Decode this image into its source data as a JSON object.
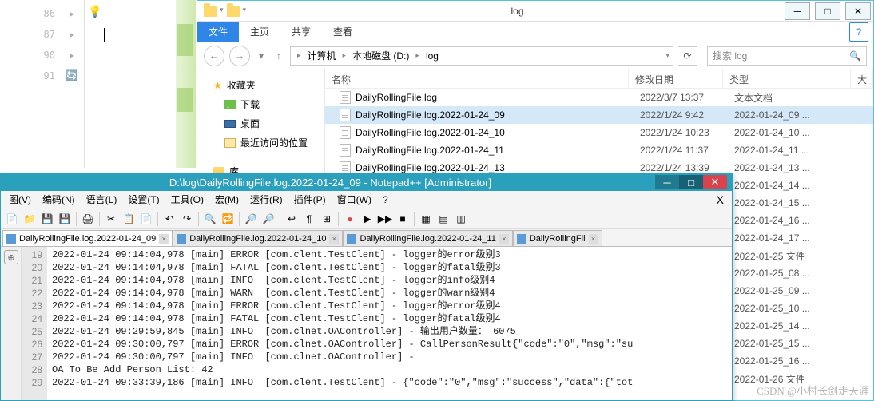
{
  "ide": {
    "lines": [
      "86",
      "87",
      "90",
      "91"
    ],
    "icons": {
      "bulb": "💡",
      "sync": "🔄"
    }
  },
  "explorer": {
    "title": "log",
    "ribbon": {
      "file": "文件",
      "home": "主页",
      "share": "共享",
      "view": "查看"
    },
    "nav": {
      "back": "←",
      "fwd": "→",
      "up": "↑",
      "refresh": "⟳"
    },
    "breadcrumb": {
      "computer": "计算机",
      "drive": "本地磁盘 (D:)",
      "folder": "log"
    },
    "search_placeholder": "搜索 log",
    "sidebar": {
      "fav": "收藏夹",
      "downloads": "下载",
      "desktop": "桌面",
      "recent": "最近访问的位置",
      "lib": "库"
    },
    "columns": {
      "name": "名称",
      "date": "修改日期",
      "type": "类型",
      "size": "大"
    },
    "rows": [
      {
        "name": "DailyRollingFile.log",
        "date": "2022/3/7 13:37",
        "type": "文本文档"
      },
      {
        "name": "DailyRollingFile.log.2022-01-24_09",
        "date": "2022/1/24 9:42",
        "type": "2022-01-24_09 ...",
        "sel": true
      },
      {
        "name": "DailyRollingFile.log.2022-01-24_10",
        "date": "2022/1/24 10:23",
        "type": "2022-01-24_10 ..."
      },
      {
        "name": "DailyRollingFile.log.2022-01-24_11",
        "date": "2022/1/24 11:37",
        "type": "2022-01-24_11 ..."
      },
      {
        "name": "DailyRollingFile.log.2022-01-24_13",
        "date": "2022/1/24 13:39",
        "type": "2022-01-24_13 ..."
      },
      {
        "name": "",
        "date": "",
        "type": "2022-01-24_14 ..."
      },
      {
        "name": "",
        "date": "",
        "type": "2022-01-24_15 ..."
      },
      {
        "name": "",
        "date": "",
        "type": "2022-01-24_16 ..."
      },
      {
        "name": "",
        "date": "",
        "type": "2022-01-24_17 ..."
      },
      {
        "name": "",
        "date": "",
        "type": "2022-01-25 文件"
      },
      {
        "name": "",
        "date": "",
        "type": "2022-01-25_08 ..."
      },
      {
        "name": "",
        "date": "",
        "type": "2022-01-25_09 ..."
      },
      {
        "name": "",
        "date": "",
        "type": "2022-01-25_10 ..."
      },
      {
        "name": "",
        "date": "",
        "type": "2022-01-25_14 ..."
      },
      {
        "name": "",
        "date": "",
        "type": "2022-01-25_15 ..."
      },
      {
        "name": "",
        "date": "",
        "type": "2022-01-25_16 ..."
      },
      {
        "name": "",
        "date": "",
        "type": "2022-01-26 文件"
      }
    ]
  },
  "npp": {
    "title": "D:\\log\\DailyRollingFile.log.2022-01-24_09 - Notepad++ [Administrator]",
    "menu": [
      "图(V)",
      "编码(N)",
      "语言(L)",
      "设置(T)",
      "工具(O)",
      "宏(M)",
      "运行(R)",
      "插件(P)",
      "窗口(W)",
      "?"
    ],
    "tabs": [
      {
        "label": "DailyRollingFile.log.2022-01-24_09",
        "active": true
      },
      {
        "label": "DailyRollingFile.log.2022-01-24_10"
      },
      {
        "label": "DailyRollingFile.log.2022-01-24_11"
      },
      {
        "label": "DailyRollingFil"
      }
    ],
    "gutter": [
      "19",
      "20",
      "21",
      "22",
      "23",
      "24",
      "25",
      "26",
      "27",
      "28",
      "29"
    ],
    "lines": [
      "2022-01-24 09:14:04,978 [main] ERROR [com.clent.TestClent] - logger的error级别3",
      "2022-01-24 09:14:04,978 [main] FATAL [com.clent.TestClent] - logger的fatal级别3",
      "2022-01-24 09:14:04,978 [main] INFO  [com.clent.TestClent] - logger的info级别4",
      "2022-01-24 09:14:04,978 [main] WARN  [com.clent.TestClent] - logger的warn级别4",
      "2022-01-24 09:14:04,978 [main] ERROR [com.clent.TestClent] - logger的error级别4",
      "2022-01-24 09:14:04,978 [main] FATAL [com.clent.TestClent] - logger的fatal级别4",
      "2022-01-24 09:29:59,845 [main] INFO  [com.clnet.OAController] - 输出用户数量： 6075",
      "2022-01-24 09:30:00,797 [main] ERROR [com.clnet.OAController] - CallPersonResult{\"code\":\"0\",\"msg\":\"su",
      "2022-01-24 09:30:00,797 [main] INFO  [com.clnet.OAController] - ",
      "OA To Be Add Person List: 42",
      "2022-01-24 09:33:39,186 [main] INFO  [com.clent.TestClent] - {\"code\":\"0\",\"msg\":\"success\",\"data\":{\"tot"
    ]
  },
  "watermark": "CSDN @小村长剑走天涯"
}
